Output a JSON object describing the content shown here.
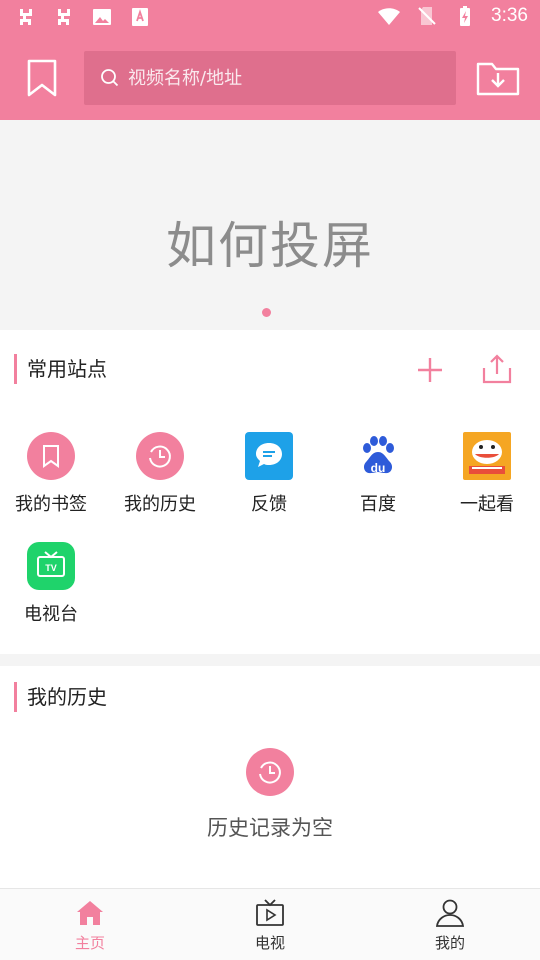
{
  "status_bar": {
    "time": "3:36",
    "icons": [
      "bug-icon",
      "bug-icon",
      "image-icon",
      "font-icon",
      "wifi-icon",
      "no-sim-icon",
      "battery-charging-icon"
    ]
  },
  "header": {
    "search_placeholder": "视频名称/地址",
    "icons": [
      "bookmark-icon",
      "search-icon",
      "download-folder-icon"
    ]
  },
  "banner": {
    "text": "如何投屏",
    "pages": 1,
    "active_page": 1
  },
  "sites_section": {
    "title": "常用站点",
    "actions": [
      "plus-icon",
      "share-upload-icon"
    ],
    "items": [
      {
        "label": "我的书签",
        "icon": "bookmark-icon"
      },
      {
        "label": "我的历史",
        "icon": "history-clock-icon"
      },
      {
        "label": "反馈",
        "icon": "feedback-chat-icon"
      },
      {
        "label": "百度",
        "icon": "baidu-paw-icon"
      },
      {
        "label": "一起看",
        "icon": "douyu-shark-icon"
      },
      {
        "label": "电视台",
        "icon": "tv-icon"
      }
    ]
  },
  "history_section": {
    "title": "我的历史",
    "empty_text": "历史记录为空",
    "icon": "history-clock-icon"
  },
  "tabs": [
    {
      "label": "主页",
      "icon": "home-icon",
      "active": true
    },
    {
      "label": "电视",
      "icon": "tv-play-icon",
      "active": false
    },
    {
      "label": "我的",
      "icon": "user-icon",
      "active": false
    }
  ],
  "colors": {
    "accent": "#f2809e",
    "feedback": "#1ea1e8",
    "baidu": "#2e5bd9",
    "tv": "#1fd36b",
    "douyu": "#f5a623"
  }
}
